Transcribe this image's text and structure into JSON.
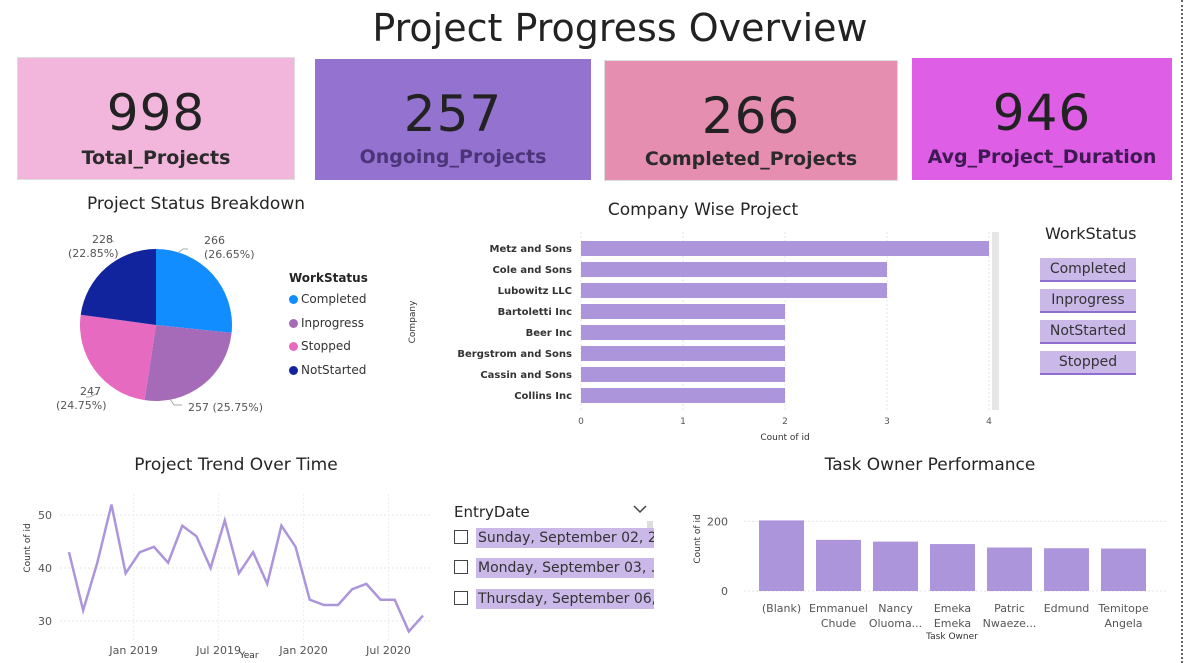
{
  "page_title": "Project Progress Overview",
  "cards": [
    {
      "value": "998",
      "label": "Total_Projects",
      "color": "#f2b6dc"
    },
    {
      "value": "257",
      "label": "Ongoing_Projects",
      "color": "#9373cf"
    },
    {
      "value": "266",
      "label": "Completed_Projects",
      "color": "#e68eb0"
    },
    {
      "value": "946",
      "label": "Avg_Project_Duration",
      "color": "#de5ee6"
    }
  ],
  "status_pie": {
    "title": "Project Status Breakdown",
    "legend_title": "WorkStatus",
    "legend": [
      {
        "name": "Completed",
        "color": "#118dff"
      },
      {
        "name": "Inprogress",
        "color": "#a66bb8"
      },
      {
        "name": "Stopped",
        "color": "#e66ac0"
      },
      {
        "name": "NotStarted",
        "color": "#12239e"
      }
    ],
    "labels": [
      {
        "line1": "266",
        "line2": "(26.65%)"
      },
      {
        "line1": "257 (25.75%)",
        "line2": ""
      },
      {
        "line1": "247",
        "line2": "(24.75%)"
      },
      {
        "line1": "228",
        "line2": "(22.85%)"
      }
    ]
  },
  "company_chart": {
    "title": "Company Wise Project",
    "xlabel": "Count of id",
    "ylabel": "Company"
  },
  "workstatus_slicer": {
    "title": "WorkStatus",
    "items": [
      "Completed",
      "Inprogress",
      "NotStarted",
      "Stopped"
    ]
  },
  "trend_chart": {
    "title": "Project Trend Over Time",
    "xlabel": "Year",
    "ylabel": "Count of id",
    "x_ticks": [
      "Jan 2019",
      "Jul 2019",
      "Jan 2020",
      "Jul 2020"
    ],
    "y_ticks": [
      "30",
      "40",
      "50"
    ]
  },
  "entry_date_slicer": {
    "title": "EntryDate",
    "items": [
      "Sunday, September 02, 2...",
      "Monday, September 03, ...",
      "Thursday, September 06, ..."
    ]
  },
  "owner_chart": {
    "title": "Task Owner Performance",
    "xlabel": "Task Owner",
    "ylabel": "Count of id",
    "y_ticks": [
      "0",
      "200"
    ]
  },
  "chart_data": [
    {
      "type": "pie",
      "title": "Project Status Breakdown",
      "categories": [
        "Completed",
        "Inprogress",
        "Stopped",
        "NotStarted"
      ],
      "values": [
        266,
        257,
        247,
        228
      ],
      "percentages": [
        26.65,
        25.75,
        24.75,
        22.85
      ],
      "colors": [
        "#118dff",
        "#a66bb8",
        "#e66ac0",
        "#12239e"
      ],
      "legend": "right"
    },
    {
      "type": "bar",
      "orientation": "horizontal",
      "title": "Company Wise Project",
      "xlabel": "Count of id",
      "ylabel": "Company",
      "categories": [
        "Metz and Sons",
        "Cole and Sons",
        "Lubowitz LLC",
        "Bartoletti Inc",
        "Beer Inc",
        "Bergstrom and Sons",
        "Cassin and Sons",
        "Collins Inc"
      ],
      "values": [
        4,
        3,
        3,
        2,
        2,
        2,
        2,
        2
      ],
      "xlim": [
        0,
        4
      ],
      "x_ticks": [
        "0",
        "1",
        "2",
        "3",
        "4"
      ],
      "color": "#ad95dc"
    },
    {
      "type": "line",
      "title": "Project Trend Over Time",
      "xlabel": "Year",
      "ylabel": "Count of id",
      "x": [
        "2018-09",
        "2018-10",
        "2018-11",
        "2018-12",
        "2019-01",
        "2019-02",
        "2019-03",
        "2019-04",
        "2019-05",
        "2019-06",
        "2019-07",
        "2019-08",
        "2019-09",
        "2019-10",
        "2019-11",
        "2019-12",
        "2020-01",
        "2020-02",
        "2020-03",
        "2020-04",
        "2020-05",
        "2020-06",
        "2020-07",
        "2020-08",
        "2020-09",
        "2020-10"
      ],
      "values": [
        43,
        32,
        41,
        52,
        39,
        43,
        44,
        41,
        48,
        46,
        40,
        49,
        39,
        43,
        37,
        48,
        44,
        34,
        33,
        33,
        36,
        37,
        34,
        34,
        28,
        31
      ],
      "ylim": [
        26,
        54
      ],
      "color": "#ad95dc"
    },
    {
      "type": "bar",
      "title": "Task Owner Performance",
      "xlabel": "Task Owner",
      "ylabel": "Count of id",
      "categories": [
        "(Blank)",
        "Emmanuel Chude",
        "Nancy Oluoma...",
        "Emeka Emeka",
        "Patric Nwaeze...",
        "Edmund",
        "Temitope Angela"
      ],
      "values": [
        203,
        147,
        142,
        135,
        125,
        123,
        122
      ],
      "ylim": [
        0,
        230
      ],
      "color": "#ad95dc"
    }
  ]
}
